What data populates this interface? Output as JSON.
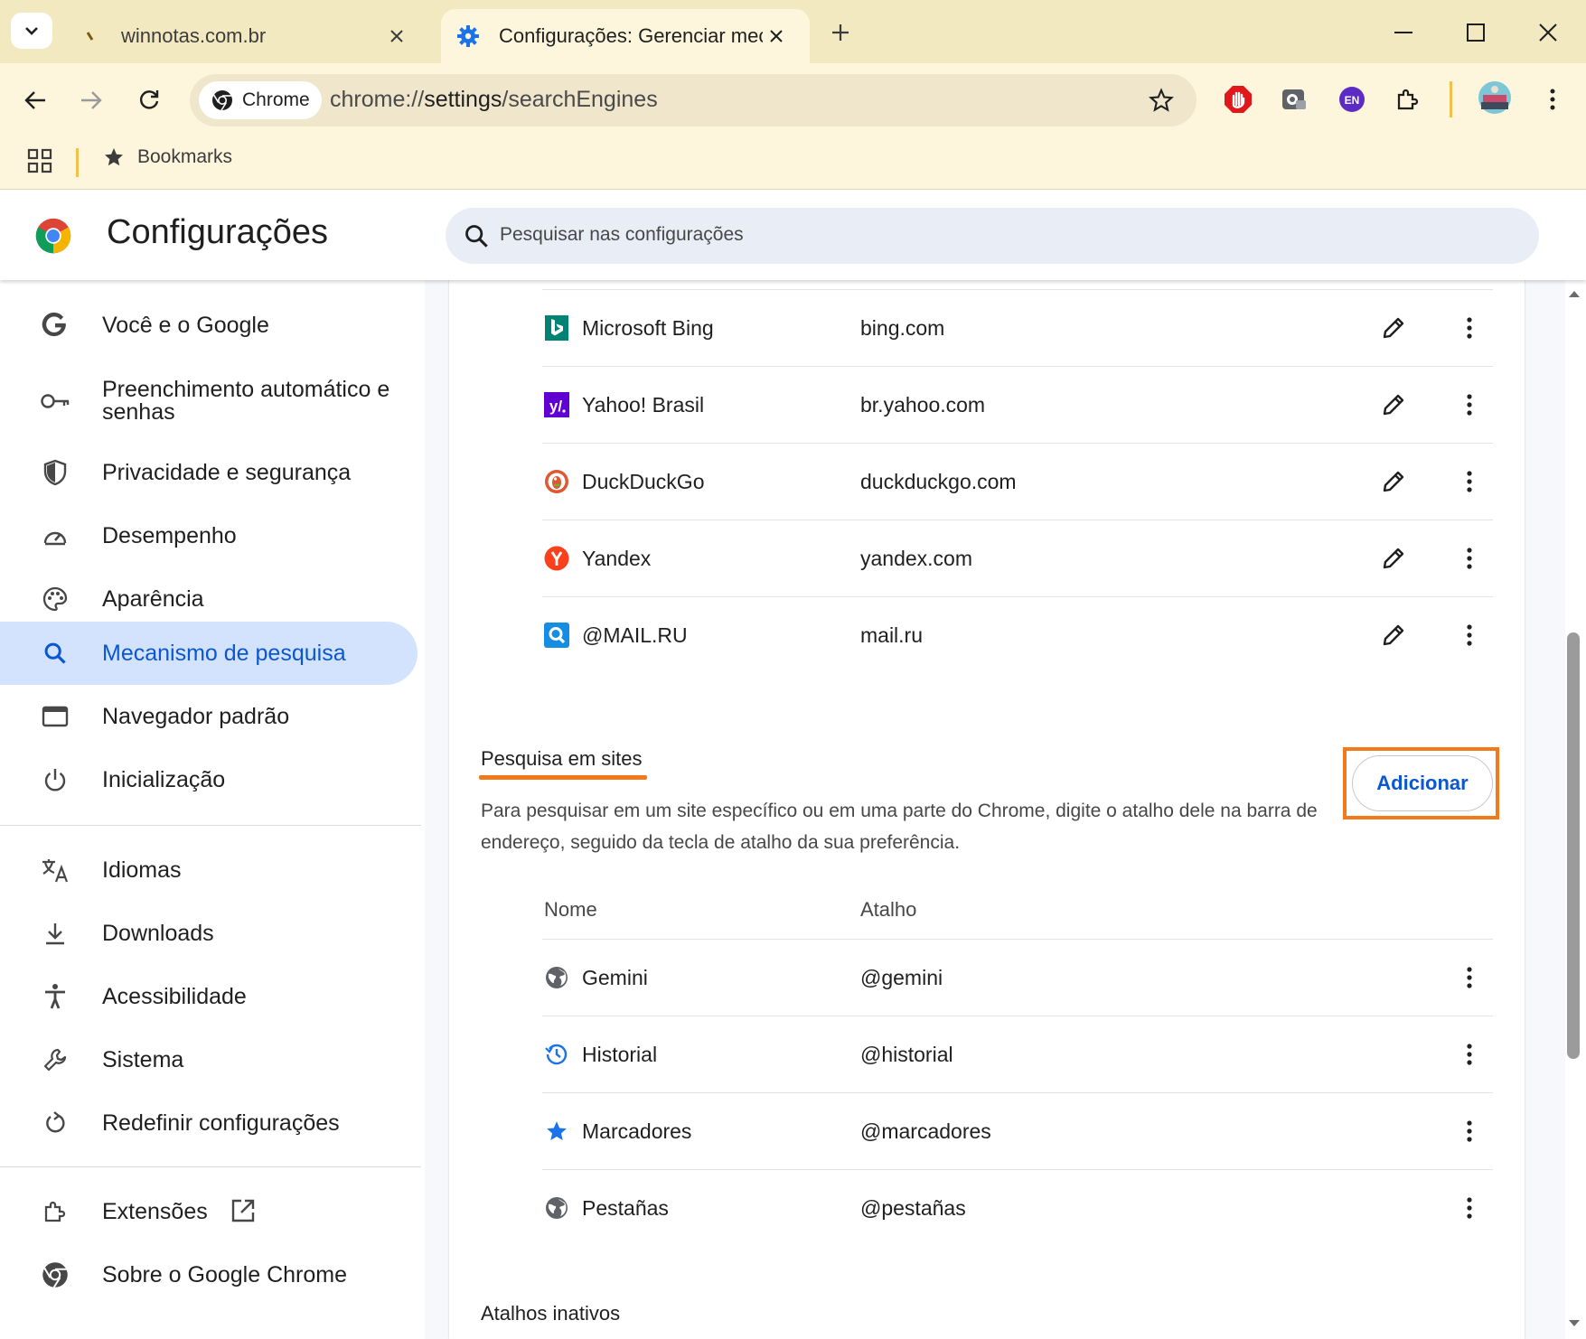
{
  "tabs": [
    {
      "title": "winnotas.com.br",
      "active": false
    },
    {
      "title": "Configurações: Gerenciar mecanis",
      "active": true
    }
  ],
  "toolbar": {
    "chip_label": "Chrome",
    "url_prefix": "chrome://",
    "url_host": "settings",
    "url_path": "/searchEngines",
    "extensions": [
      "adblock-icon",
      "screenshot-extension-icon",
      "translate-en-icon",
      "puzzle-extensions-icon"
    ],
    "translate_badge": "EN"
  },
  "bookmarks_bar": {
    "label": "Bookmarks"
  },
  "settings": {
    "title": "Configurações",
    "search_placeholder": "Pesquisar nas configurações"
  },
  "sidebar": {
    "items": [
      {
        "label": "Você e o Google",
        "icon": "google-g-icon"
      },
      {
        "label": "Preenchimento automático e senhas",
        "icon": "key-icon"
      },
      {
        "label": "Privacidade e segurança",
        "icon": "shield-icon"
      },
      {
        "label": "Desempenho",
        "icon": "speedometer-icon"
      },
      {
        "label": "Aparência",
        "icon": "palette-icon"
      },
      {
        "label": "Mecanismo de pesquisa",
        "icon": "search-icon",
        "selected": true
      },
      {
        "label": "Navegador padrão",
        "icon": "browser-window-icon"
      },
      {
        "label": "Inicialização",
        "icon": "power-icon"
      },
      {
        "label": "Idiomas",
        "icon": "translate-icon"
      },
      {
        "label": "Downloads",
        "icon": "download-icon"
      },
      {
        "label": "Acessibilidade",
        "icon": "accessibility-icon"
      },
      {
        "label": "Sistema",
        "icon": "wrench-icon"
      },
      {
        "label": "Redefinir configurações",
        "icon": "reset-icon"
      },
      {
        "label": "Extensões",
        "icon": "puzzle-icon"
      },
      {
        "label": "Sobre o Google Chrome",
        "icon": "chrome-icon"
      }
    ]
  },
  "search_engines": [
    {
      "name": "Microsoft Bing",
      "url": "bing.com"
    },
    {
      "name": "Yahoo! Brasil",
      "url": "br.yahoo.com"
    },
    {
      "name": "DuckDuckGo",
      "url": "duckduckgo.com"
    },
    {
      "name": "Yandex",
      "url": "yandex.com"
    },
    {
      "name": "@MAIL.RU",
      "url": "mail.ru"
    }
  ],
  "site_search": {
    "title": "Pesquisa em sites",
    "description": "Para pesquisar em um site específico ou em uma parte do Chrome, digite o atalho dele na barra de endereço, seguido da tecla de atalho da sua preferência.",
    "add_button": "Adicionar",
    "col_name": "Nome",
    "col_shortcut": "Atalho",
    "rows": [
      {
        "name": "Gemini",
        "shortcut": "@gemini"
      },
      {
        "name": "Historial",
        "shortcut": "@historial"
      },
      {
        "name": "Marcadores",
        "shortcut": "@marcadores"
      },
      {
        "name": "Pestañas",
        "shortcut": "@pestañas"
      }
    ]
  },
  "inactive_shortcuts": {
    "title": "Atalhos inativos"
  },
  "colors": {
    "frame": "#f3e9c0",
    "toolbar": "#fdf6dc",
    "accent_blue": "#0b57d0",
    "selected_bg": "#d3e3fd",
    "highlight_orange": "#f27a1a"
  }
}
